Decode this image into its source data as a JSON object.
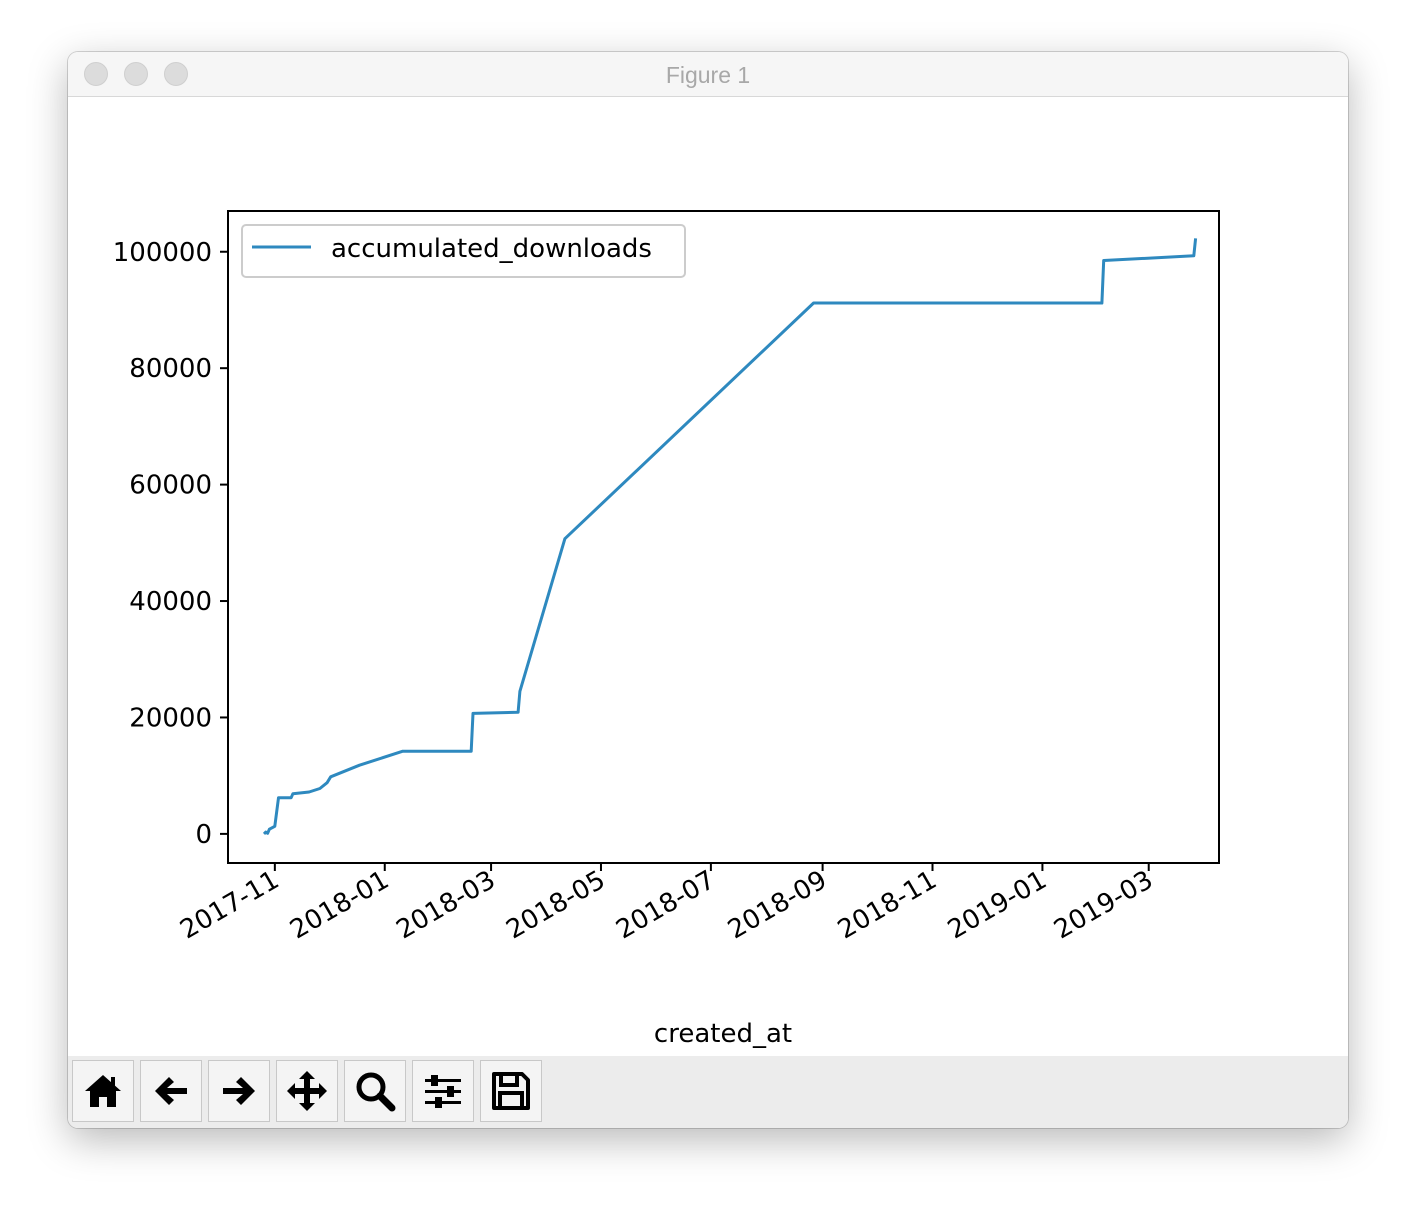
{
  "window": {
    "title": "Figure 1"
  },
  "toolbar": {
    "buttons": [
      {
        "name": "home",
        "icon": "home-icon"
      },
      {
        "name": "back",
        "icon": "arrow-left-icon"
      },
      {
        "name": "forward",
        "icon": "arrow-right-icon"
      },
      {
        "name": "pan",
        "icon": "move-icon"
      },
      {
        "name": "zoom",
        "icon": "zoom-icon"
      },
      {
        "name": "configure-subplots",
        "icon": "sliders-icon"
      },
      {
        "name": "save",
        "icon": "save-icon"
      }
    ]
  },
  "chart_data": {
    "type": "line",
    "xlabel": "created_at",
    "ylabel": "",
    "x_ticks": [
      "2017-11",
      "2018-01",
      "2018-03",
      "2018-05",
      "2018-07",
      "2018-09",
      "2018-11",
      "2019-01",
      "2019-03"
    ],
    "y_ticks": [
      "0",
      "20000",
      "40000",
      "60000",
      "80000",
      "100000"
    ],
    "xlim": [
      "2017-10-06",
      "2019-04-09"
    ],
    "ylim": [
      -5000,
      107000
    ],
    "grid": false,
    "legend_position": "upper-left",
    "line_color": "#2e89bf",
    "series": [
      {
        "name": "accumulated_downloads",
        "points": [
          [
            "2017-10-26",
            0
          ],
          [
            "2017-10-27",
            300
          ],
          [
            "2017-10-28",
            100
          ],
          [
            "2017-10-29",
            800
          ],
          [
            "2017-11-01",
            1300
          ],
          [
            "2017-11-03",
            6200
          ],
          [
            "2017-11-10",
            6200
          ],
          [
            "2017-11-11",
            6900
          ],
          [
            "2017-11-20",
            7200
          ],
          [
            "2017-11-26",
            7800
          ],
          [
            "2017-11-30",
            8800
          ],
          [
            "2017-12-02",
            9800
          ],
          [
            "2017-12-18",
            11800
          ],
          [
            "2018-01-11",
            14200
          ],
          [
            "2018-02-18",
            14200
          ],
          [
            "2018-02-19",
            20700
          ],
          [
            "2018-03-16",
            20900
          ],
          [
            "2018-03-17",
            24500
          ],
          [
            "2018-04-11",
            50700
          ],
          [
            "2018-08-27",
            91200
          ],
          [
            "2019-02-03",
            91200
          ],
          [
            "2019-02-04",
            98500
          ],
          [
            "2019-03-26",
            99300
          ],
          [
            "2019-03-27",
            102300
          ]
        ]
      }
    ]
  }
}
